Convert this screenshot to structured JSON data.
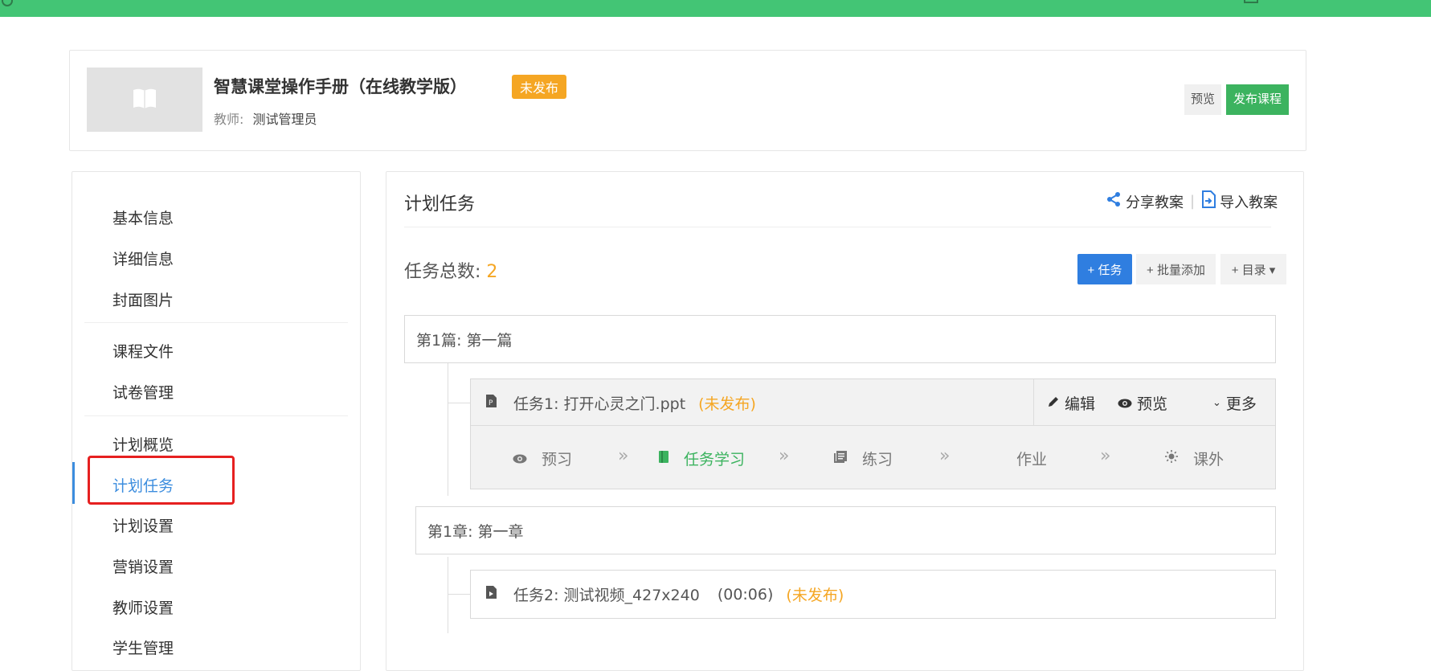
{
  "course": {
    "title": "智慧课堂操作手册（在线教学版）",
    "status_badge": "未发布",
    "teacher_label": "教师:",
    "teacher_name": "测试管理员",
    "preview_btn": "预览",
    "publish_btn": "发布课程"
  },
  "sidebar": {
    "groups": [
      [
        "基本信息",
        "详细信息",
        "封面图片"
      ],
      [
        "课程文件",
        "试卷管理"
      ],
      [
        "计划概览",
        "计划任务",
        "计划设置",
        "营销设置",
        "教师设置",
        "学生管理"
      ]
    ],
    "active": "计划任务"
  },
  "main": {
    "title": "计划任务",
    "share_label": "分享教案",
    "import_label": "导入教案",
    "count_label": "任务总数:",
    "count_value": "2",
    "add_task_btn": "+ 任务",
    "batch_add_btn": "+ 批量添加",
    "catalog_btn": "+ 目录 ▾",
    "sections": [
      {
        "title": "第1篇: 第一篇",
        "tasks": [
          {
            "name": "任务1:  打开心灵之门.ppt",
            "status": "(未发布)",
            "actions": [
              "编辑",
              "预览",
              "更多"
            ],
            "steps": [
              "预习",
              "任务学习",
              "练习",
              "作业",
              "课外"
            ],
            "active_step": "任务学习"
          }
        ]
      },
      {
        "title": "第1章: 第一章",
        "tasks": [
          {
            "name": "任务2:  测试视频_427x240",
            "duration": "(00:06)",
            "status": "(未发布)"
          }
        ]
      }
    ]
  },
  "colors": {
    "topbar": "#43c575",
    "primary_blue": "#2f7ee0",
    "publish_green": "#3cb35f",
    "warning_orange": "#f5a623",
    "highlight_red": "#e62020"
  }
}
